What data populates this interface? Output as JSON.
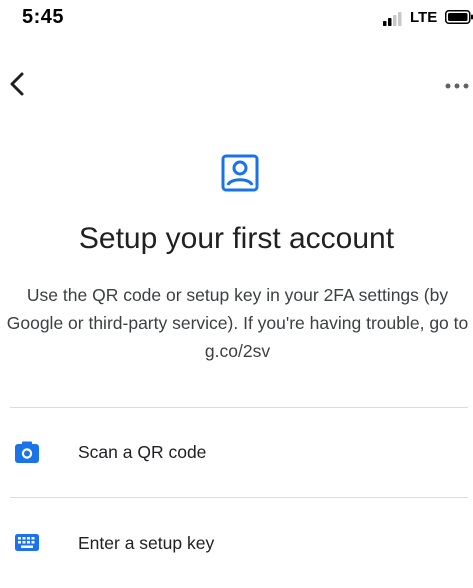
{
  "status_bar": {
    "time": "5:45",
    "network": "LTE"
  },
  "header": {
    "back_icon": "chevron-left-icon",
    "more_icon": "more-horizontal-icon"
  },
  "hero": {
    "icon": "account-box-icon",
    "accent_color": "#1a73e8"
  },
  "title": "Setup your first account",
  "description": "Use the QR code or setup key in your 2FA settings (by Google or third-party service). If you're having trouble, go to g.co/2sv",
  "options": [
    {
      "icon": "camera-icon",
      "label": "Scan a QR code"
    },
    {
      "icon": "keyboard-icon",
      "label": "Enter a setup key"
    }
  ]
}
